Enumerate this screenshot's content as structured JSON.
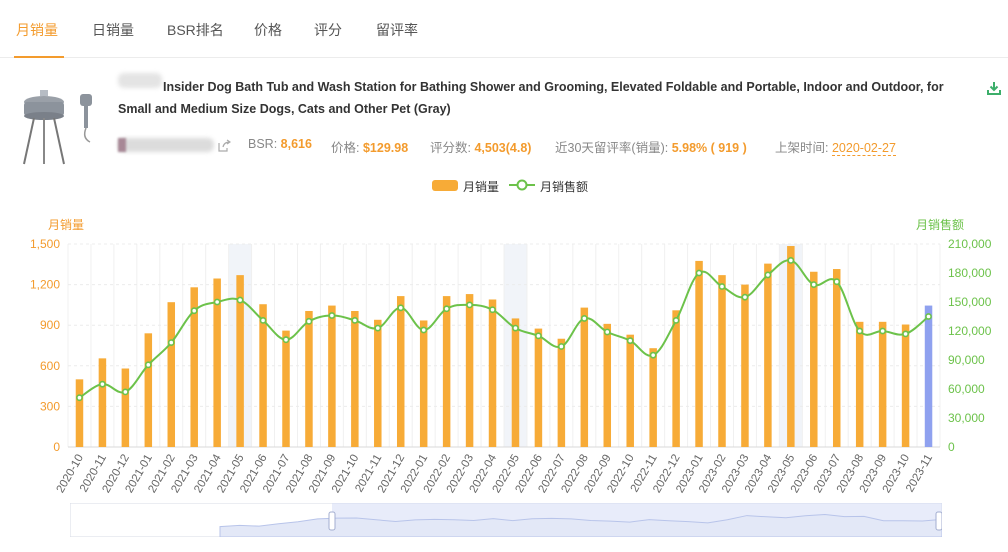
{
  "tabs": [
    {
      "label": "月销量",
      "active": true
    },
    {
      "label": "日销量",
      "active": false
    },
    {
      "label": "BSR排名",
      "active": false
    },
    {
      "label": "价格",
      "active": false
    },
    {
      "label": "评分",
      "active": false
    },
    {
      "label": "留评率",
      "active": false
    }
  ],
  "product": {
    "title": "Insider Dog Bath Tub and Wash Station for Bathing Shower and Grooming, Elevated Foldable and Portable, Indoor and Outdoor, for Small and Medium Size Dogs, Cats and Other Pet (Gray)",
    "stats": {
      "bsr_label": "BSR:",
      "bsr_value": "8,616",
      "price_label": "价格:",
      "price_value": "$129.98",
      "reviews_label": "评分数:",
      "reviews_value": "4,503(4.8)",
      "review_rate_label": "近30天留评率(销量):",
      "review_rate_value": "5.98% ( 919 )",
      "listed_label": "上架时间:",
      "listed_value": "2020-02-27"
    }
  },
  "legend": {
    "bar_label": "月销量",
    "line_label": "月销售额"
  },
  "colors": {
    "accent": "#f39b2d",
    "bar": "#f7ab37",
    "bar_current": "#8fa1ef",
    "line": "#6cc24a"
  },
  "chart_data": {
    "type": "bar",
    "left_axis_title": "月销量",
    "right_axis_title": "月销售额",
    "categories": [
      "2020-10",
      "2020-11",
      "2020-12",
      "2021-01",
      "2021-02",
      "2021-03",
      "2021-04",
      "2021-05",
      "2021-06",
      "2021-07",
      "2021-08",
      "2021-09",
      "2021-10",
      "2021-11",
      "2021-12",
      "2022-01",
      "2022-02",
      "2022-03",
      "2022-04",
      "2022-05",
      "2022-06",
      "2022-07",
      "2022-08",
      "2022-09",
      "2022-10",
      "2022-11",
      "2022-12",
      "2023-01",
      "2023-02",
      "2023-03",
      "2023-04",
      "2023-05",
      "2023-06",
      "2023-07",
      "2023-08",
      "2023-09",
      "2023-10",
      "2023-11"
    ],
    "series": [
      {
        "name": "月销量",
        "type": "bar",
        "axis": "left",
        "values": [
          500,
          655,
          580,
          840,
          1070,
          1180,
          1245,
          1270,
          1055,
          860,
          1005,
          1045,
          1005,
          940,
          1115,
          935,
          1115,
          1130,
          1090,
          950,
          875,
          800,
          1030,
          910,
          830,
          730,
          1010,
          1375,
          1270,
          1200,
          1355,
          1485,
          1295,
          1315,
          925,
          925,
          905,
          1045
        ]
      },
      {
        "name": "月销售额",
        "type": "line",
        "axis": "right",
        "values": [
          51000,
          65000,
          57000,
          85000,
          108000,
          141000,
          150000,
          152000,
          131000,
          111000,
          130000,
          136000,
          131000,
          123000,
          144000,
          121000,
          143000,
          147000,
          142000,
          123000,
          115000,
          104000,
          133000,
          119000,
          110000,
          95000,
          131000,
          180000,
          166000,
          155000,
          178000,
          193000,
          168000,
          171000,
          120000,
          120000,
          117000,
          135000
        ]
      }
    ],
    "left_ylim": [
      0,
      1500
    ],
    "right_ylim": [
      0,
      210000
    ],
    "left_ticks": [
      "0",
      "300",
      "600",
      "900",
      "1,200",
      "1,500"
    ],
    "right_ticks": [
      "0",
      "30,000",
      "60,000",
      "90,000",
      "120,000",
      "150,000",
      "180,000",
      "210,000"
    ],
    "highlighted_months": [
      "2021-05",
      "2022-05",
      "2023-05"
    ],
    "current_month": "2023-11"
  }
}
